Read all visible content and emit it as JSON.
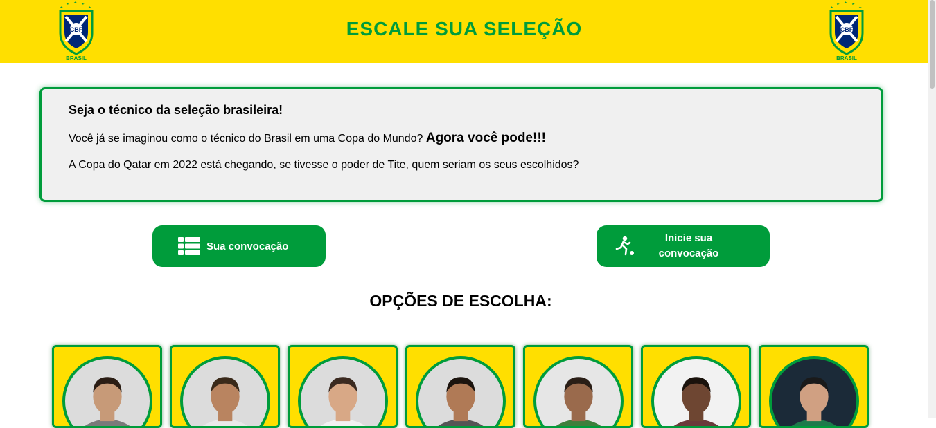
{
  "header": {
    "title": "ESCALE SUA SELEÇÃO",
    "logo_text": "CBF",
    "logo_subtext": "BRASIL",
    "colors": {
      "yellow": "#ffdf00",
      "green": "#009c3b",
      "blue": "#002776"
    }
  },
  "intro": {
    "heading": "Seja o técnico da seleção brasileira!",
    "line1": "Você já se imaginou como o técnico do Brasil em uma Copa do Mundo?",
    "line1_emphasis": "Agora você pode!!!",
    "line2": "A Copa do Qatar em 2022 está chegando, se tivesse o poder de Tite, quem seriam os seus escolhidos?"
  },
  "buttons": {
    "squad_label": "Sua convocação",
    "squad_icon": "list-icon",
    "start_label": "Inicie sua convocação",
    "start_icon": "soccer-player-icon"
  },
  "options": {
    "title": "OPÇÕES DE ESCOLHA:",
    "players": [
      {
        "shirt": "#7a7a7a",
        "skin": "#c79a78",
        "hair": "#2b1d14",
        "bg": "#dcdcdc"
      },
      {
        "shirt": "#e9e9e9",
        "skin": "#b98460",
        "hair": "#3a2a1a",
        "bg": "#dcdcdc"
      },
      {
        "shirt": "#f2f2f2",
        "skin": "#d8a886",
        "hair": "#3b2a20",
        "bg": "#dcdcdc"
      },
      {
        "shirt": "#555555",
        "skin": "#b07a56",
        "hair": "#1c140e",
        "bg": "#dcdcdc"
      },
      {
        "shirt": "#3f7f3c",
        "skin": "#9a6a4c",
        "hair": "#2a1e16",
        "bg": "#e6e6e6"
      },
      {
        "shirt": "#6a3a3a",
        "skin": "#6e4632",
        "hair": "#1a120c",
        "bg": "#f2f2f2"
      },
      {
        "shirt": "#1d7a4b",
        "skin": "#d0a082",
        "hair": "#1a1a1a",
        "bg": "#1b2a38"
      }
    ]
  }
}
